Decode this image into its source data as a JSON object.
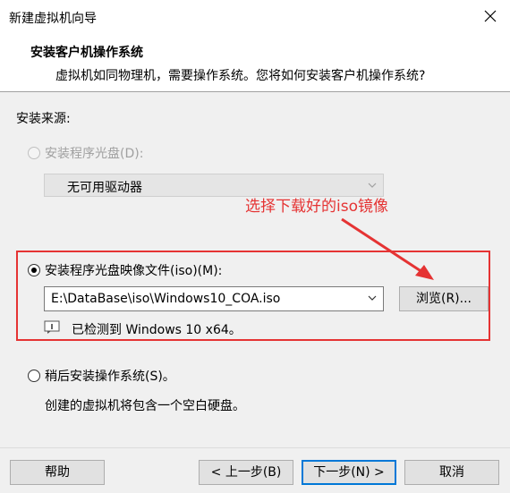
{
  "window": {
    "title": "新建虚拟机向导"
  },
  "header": {
    "title": "安装客户机操作系统",
    "subtitle": "虚拟机如同物理机，需要操作系统。您将如何安装客户机操作系统?"
  },
  "install_source": {
    "label": "安装来源:",
    "disc_option": {
      "label": "安装程序光盘(D):",
      "selected": false,
      "enabled": false,
      "drive_value": "无可用驱动器"
    },
    "iso_option": {
      "label": "安装程序光盘映像文件(iso)(M):",
      "selected": true,
      "path_value": "E:\\DataBase\\iso\\Windows10_COA.iso",
      "browse_label": "浏览(R)...",
      "detected_text": "已检测到 Windows 10 x64。"
    },
    "later_option": {
      "label": "稍后安装操作系统(S)。",
      "selected": false,
      "description": "创建的虚拟机将包含一个空白硬盘。"
    }
  },
  "annotation": {
    "text": "选择下载好的iso镜像",
    "color": "#e53333"
  },
  "footer": {
    "help_label": "帮助",
    "back_label": "< 上一步(B)",
    "next_label": "下一步(N) >",
    "cancel_label": "取消"
  }
}
